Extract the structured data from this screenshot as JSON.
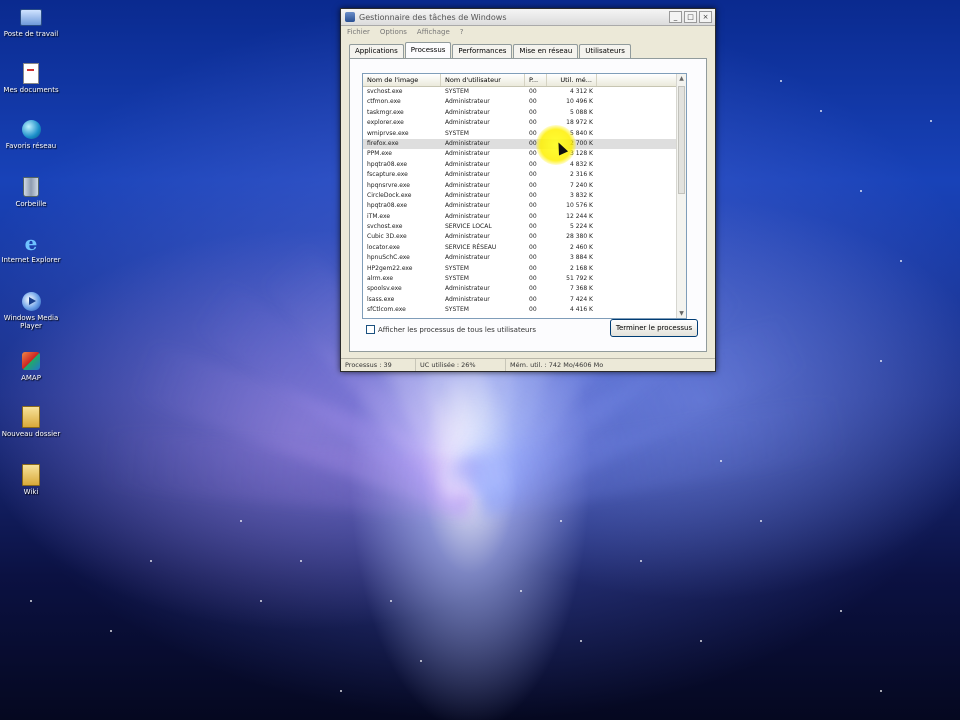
{
  "desktop": {
    "icons": [
      {
        "label": "Poste de travail",
        "icon": "computer-icon"
      },
      {
        "label": "Mes documents",
        "icon": "documents-icon"
      },
      {
        "label": "Favoris réseau",
        "icon": "network-icon"
      },
      {
        "label": "Corbeille",
        "icon": "recycle-bin-icon"
      },
      {
        "label": "Internet Explorer",
        "icon": "internet-explorer-icon"
      },
      {
        "label": "Windows Media Player",
        "icon": "media-player-icon"
      },
      {
        "label": "AMAP",
        "icon": "application-icon"
      },
      {
        "label": "Nouveau dossier",
        "icon": "folder-icon"
      },
      {
        "label": "Wiki",
        "icon": "folder-icon"
      }
    ]
  },
  "window": {
    "title": "Gestionnaire des tâches de Windows",
    "menu": [
      "Fichier",
      "Options",
      "Affichage",
      "?"
    ],
    "tabs": [
      "Applications",
      "Processus",
      "Performances",
      "Mise en réseau",
      "Utilisateurs"
    ],
    "active_tab": "Processus",
    "columns": [
      "Nom de l'image",
      "Nom d'utilisateur",
      "P...",
      "Util. mé..."
    ],
    "rows": [
      {
        "name": "svchost.exe",
        "user": "SYSTEM",
        "cpu": "00",
        "mem": "4 312 K"
      },
      {
        "name": "ctfmon.exe",
        "user": "Administrateur",
        "cpu": "00",
        "mem": "10 496 K"
      },
      {
        "name": "taskmgr.exe",
        "user": "Administrateur",
        "cpu": "00",
        "mem": "5 088 K"
      },
      {
        "name": "explorer.exe",
        "user": "Administrateur",
        "cpu": "00",
        "mem": "18 972 K"
      },
      {
        "name": "wmiprvse.exe",
        "user": "SYSTEM",
        "cpu": "00",
        "mem": "5 840 K"
      },
      {
        "name": "firefox.exe",
        "user": "Administrateur",
        "cpu": "00",
        "mem": "2 700 K"
      },
      {
        "name": "PPM.exe",
        "user": "Administrateur",
        "cpu": "00",
        "mem": "3 128 K"
      },
      {
        "name": "hpqtra08.exe",
        "user": "Administrateur",
        "cpu": "00",
        "mem": "4 832 K"
      },
      {
        "name": "fscapture.exe",
        "user": "Administrateur",
        "cpu": "00",
        "mem": "2 316 K"
      },
      {
        "name": "hpqnsrvre.exe",
        "user": "Administrateur",
        "cpu": "00",
        "mem": "7 240 K"
      },
      {
        "name": "CircleDock.exe",
        "user": "Administrateur",
        "cpu": "00",
        "mem": "3 832 K"
      },
      {
        "name": "hpqtra08.exe",
        "user": "Administrateur",
        "cpu": "00",
        "mem": "10 576 K"
      },
      {
        "name": "iTM.exe",
        "user": "Administrateur",
        "cpu": "00",
        "mem": "12 244 K"
      },
      {
        "name": "svchost.exe",
        "user": "SERVICE LOCAL",
        "cpu": "00",
        "mem": "5 224 K"
      },
      {
        "name": "Cubic 3D.exe",
        "user": "Administrateur",
        "cpu": "00",
        "mem": "28 380 K"
      },
      {
        "name": "locator.exe",
        "user": "SERVICE RÉSEAU",
        "cpu": "00",
        "mem": "2 460 K"
      },
      {
        "name": "hpnuSchC.exe",
        "user": "Administrateur",
        "cpu": "00",
        "mem": "3 884 K"
      },
      {
        "name": "HP2gem22.exe",
        "user": "SYSTEM",
        "cpu": "00",
        "mem": "2 168 K"
      },
      {
        "name": "alrm.exe",
        "user": "SYSTEM",
        "cpu": "00",
        "mem": "51 792 K"
      },
      {
        "name": "spoolsv.exe",
        "user": "Administrateur",
        "cpu": "00",
        "mem": "7 368 K"
      },
      {
        "name": "lsass.exe",
        "user": "Administrateur",
        "cpu": "00",
        "mem": "7 424 K"
      },
      {
        "name": "sfCtlcom.exe",
        "user": "SYSTEM",
        "cpu": "00",
        "mem": "4 416 K"
      }
    ],
    "show_all_users_label": "Afficher les processus de tous les utilisateurs",
    "end_process_label": "Terminer le processus",
    "status": {
      "processes": "Processus : 39",
      "cpu": "UC utilisée : 26%",
      "memory": "Mém. util. : 742 Mo/4606 Mo"
    }
  }
}
